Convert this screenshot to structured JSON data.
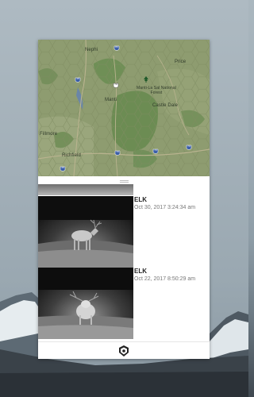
{
  "map": {
    "places": [
      "Nephi",
      "Price",
      "Manti-La Sal National Forest",
      "Manti",
      "Castle Dale",
      "Fillmore",
      "Richfield"
    ],
    "highways": [
      "89",
      "15",
      "15",
      "70",
      "70",
      "70",
      "70"
    ]
  },
  "sightings": [
    {
      "species": "ELK",
      "timestamp": "Oct 30, 2017  3:24:34 am"
    },
    {
      "species": "ELK",
      "timestamp": "Oct 22, 2017  8:50:29 am"
    }
  ],
  "colors": {
    "map_base": "#8c9b6c",
    "forest": "#6e8f55",
    "hex_grid": "#7f8c61",
    "interstate": "#3b5ea8"
  },
  "icons": {
    "app_logo": "trail-camera-logo-icon",
    "map_pin": "forest-pin-icon",
    "drag_handle": "drag-handle-icon"
  }
}
